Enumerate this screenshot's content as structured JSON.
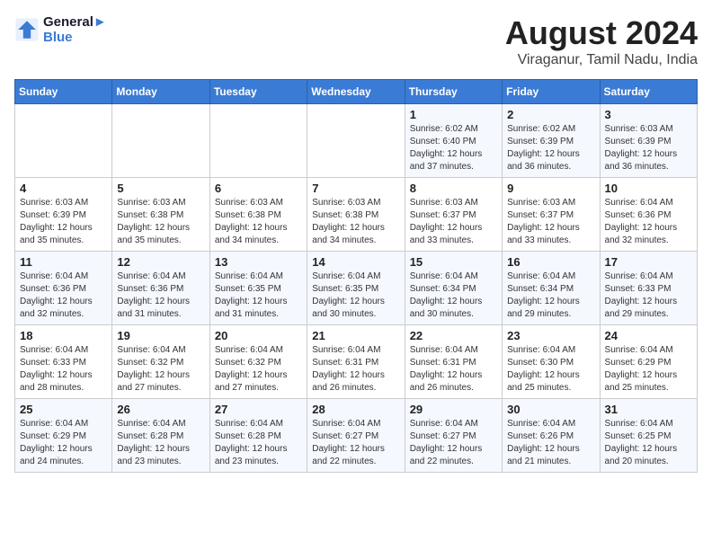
{
  "logo": {
    "line1": "General",
    "line2": "Blue"
  },
  "title": "August 2024",
  "location": "Viraganur, Tamil Nadu, India",
  "weekdays": [
    "Sunday",
    "Monday",
    "Tuesday",
    "Wednesday",
    "Thursday",
    "Friday",
    "Saturday"
  ],
  "weeks": [
    [
      {
        "day": "",
        "detail": ""
      },
      {
        "day": "",
        "detail": ""
      },
      {
        "day": "",
        "detail": ""
      },
      {
        "day": "",
        "detail": ""
      },
      {
        "day": "1",
        "detail": "Sunrise: 6:02 AM\nSunset: 6:40 PM\nDaylight: 12 hours\nand 37 minutes."
      },
      {
        "day": "2",
        "detail": "Sunrise: 6:02 AM\nSunset: 6:39 PM\nDaylight: 12 hours\nand 36 minutes."
      },
      {
        "day": "3",
        "detail": "Sunrise: 6:03 AM\nSunset: 6:39 PM\nDaylight: 12 hours\nand 36 minutes."
      }
    ],
    [
      {
        "day": "4",
        "detail": "Sunrise: 6:03 AM\nSunset: 6:39 PM\nDaylight: 12 hours\nand 35 minutes."
      },
      {
        "day": "5",
        "detail": "Sunrise: 6:03 AM\nSunset: 6:38 PM\nDaylight: 12 hours\nand 35 minutes."
      },
      {
        "day": "6",
        "detail": "Sunrise: 6:03 AM\nSunset: 6:38 PM\nDaylight: 12 hours\nand 34 minutes."
      },
      {
        "day": "7",
        "detail": "Sunrise: 6:03 AM\nSunset: 6:38 PM\nDaylight: 12 hours\nand 34 minutes."
      },
      {
        "day": "8",
        "detail": "Sunrise: 6:03 AM\nSunset: 6:37 PM\nDaylight: 12 hours\nand 33 minutes."
      },
      {
        "day": "9",
        "detail": "Sunrise: 6:03 AM\nSunset: 6:37 PM\nDaylight: 12 hours\nand 33 minutes."
      },
      {
        "day": "10",
        "detail": "Sunrise: 6:04 AM\nSunset: 6:36 PM\nDaylight: 12 hours\nand 32 minutes."
      }
    ],
    [
      {
        "day": "11",
        "detail": "Sunrise: 6:04 AM\nSunset: 6:36 PM\nDaylight: 12 hours\nand 32 minutes."
      },
      {
        "day": "12",
        "detail": "Sunrise: 6:04 AM\nSunset: 6:36 PM\nDaylight: 12 hours\nand 31 minutes."
      },
      {
        "day": "13",
        "detail": "Sunrise: 6:04 AM\nSunset: 6:35 PM\nDaylight: 12 hours\nand 31 minutes."
      },
      {
        "day": "14",
        "detail": "Sunrise: 6:04 AM\nSunset: 6:35 PM\nDaylight: 12 hours\nand 30 minutes."
      },
      {
        "day": "15",
        "detail": "Sunrise: 6:04 AM\nSunset: 6:34 PM\nDaylight: 12 hours\nand 30 minutes."
      },
      {
        "day": "16",
        "detail": "Sunrise: 6:04 AM\nSunset: 6:34 PM\nDaylight: 12 hours\nand 29 minutes."
      },
      {
        "day": "17",
        "detail": "Sunrise: 6:04 AM\nSunset: 6:33 PM\nDaylight: 12 hours\nand 29 minutes."
      }
    ],
    [
      {
        "day": "18",
        "detail": "Sunrise: 6:04 AM\nSunset: 6:33 PM\nDaylight: 12 hours\nand 28 minutes."
      },
      {
        "day": "19",
        "detail": "Sunrise: 6:04 AM\nSunset: 6:32 PM\nDaylight: 12 hours\nand 27 minutes."
      },
      {
        "day": "20",
        "detail": "Sunrise: 6:04 AM\nSunset: 6:32 PM\nDaylight: 12 hours\nand 27 minutes."
      },
      {
        "day": "21",
        "detail": "Sunrise: 6:04 AM\nSunset: 6:31 PM\nDaylight: 12 hours\nand 26 minutes."
      },
      {
        "day": "22",
        "detail": "Sunrise: 6:04 AM\nSunset: 6:31 PM\nDaylight: 12 hours\nand 26 minutes."
      },
      {
        "day": "23",
        "detail": "Sunrise: 6:04 AM\nSunset: 6:30 PM\nDaylight: 12 hours\nand 25 minutes."
      },
      {
        "day": "24",
        "detail": "Sunrise: 6:04 AM\nSunset: 6:29 PM\nDaylight: 12 hours\nand 25 minutes."
      }
    ],
    [
      {
        "day": "25",
        "detail": "Sunrise: 6:04 AM\nSunset: 6:29 PM\nDaylight: 12 hours\nand 24 minutes."
      },
      {
        "day": "26",
        "detail": "Sunrise: 6:04 AM\nSunset: 6:28 PM\nDaylight: 12 hours\nand 23 minutes."
      },
      {
        "day": "27",
        "detail": "Sunrise: 6:04 AM\nSunset: 6:28 PM\nDaylight: 12 hours\nand 23 minutes."
      },
      {
        "day": "28",
        "detail": "Sunrise: 6:04 AM\nSunset: 6:27 PM\nDaylight: 12 hours\nand 22 minutes."
      },
      {
        "day": "29",
        "detail": "Sunrise: 6:04 AM\nSunset: 6:27 PM\nDaylight: 12 hours\nand 22 minutes."
      },
      {
        "day": "30",
        "detail": "Sunrise: 6:04 AM\nSunset: 6:26 PM\nDaylight: 12 hours\nand 21 minutes."
      },
      {
        "day": "31",
        "detail": "Sunrise: 6:04 AM\nSunset: 6:25 PM\nDaylight: 12 hours\nand 20 minutes."
      }
    ]
  ]
}
